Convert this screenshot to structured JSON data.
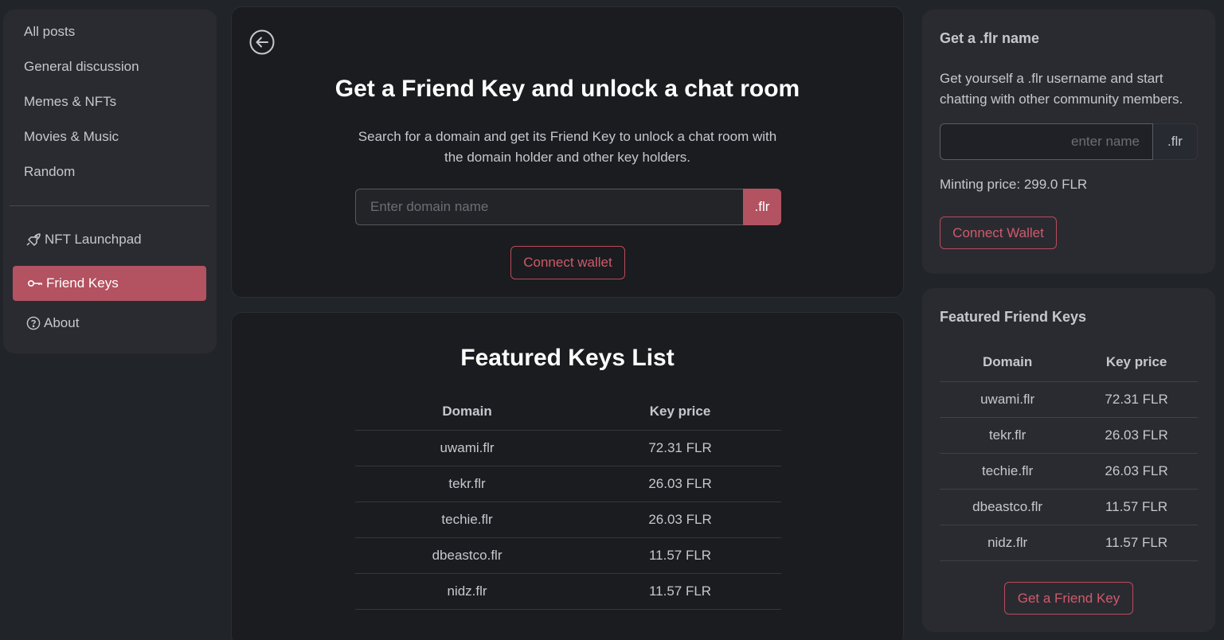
{
  "sidebar": {
    "items": [
      {
        "label": "All posts"
      },
      {
        "label": "General discussion"
      },
      {
        "label": "Memes & NFTs"
      },
      {
        "label": "Movies & Music"
      },
      {
        "label": "Random"
      }
    ],
    "special_items": [
      {
        "label": "NFT Launchpad",
        "icon": "rocket-icon"
      },
      {
        "label": "Friend Keys",
        "icon": "key-icon",
        "active": true
      },
      {
        "label": "About",
        "icon": "help-circle-icon"
      }
    ]
  },
  "hero": {
    "back_icon": "arrow-left-circle-icon",
    "title": "Get a Friend Key and unlock a chat room",
    "description": "Search for a domain and get its Friend Key to unlock a chat room with the domain holder and other key holders.",
    "search_placeholder": "Enter domain name",
    "search_value": "",
    "suffix": ".flr",
    "connect_label": "Connect wallet"
  },
  "featured_list": {
    "title": "Featured Keys List",
    "columns": [
      "Domain",
      "Key price"
    ],
    "rows": [
      {
        "domain": "uwami.flr",
        "price": "72.31 FLR"
      },
      {
        "domain": "tekr.flr",
        "price": "26.03 FLR"
      },
      {
        "domain": "techie.flr",
        "price": "26.03 FLR"
      },
      {
        "domain": "dbeastco.flr",
        "price": "11.57 FLR"
      },
      {
        "domain": "nidz.flr",
        "price": "11.57 FLR"
      }
    ]
  },
  "flr_name": {
    "title": "Get a .flr name",
    "description": "Get yourself a .flr username and start chatting with other community members.",
    "input_placeholder": "enter name",
    "input_value": "",
    "suffix": ".flr",
    "minting_price": "Minting price: 299.0 FLR",
    "connect_label": "Connect Wallet"
  },
  "featured_friend_keys": {
    "title": "Featured Friend Keys",
    "columns": [
      "Domain",
      "Key price"
    ],
    "rows": [
      {
        "domain": "uwami.flr",
        "price": "72.31 FLR"
      },
      {
        "domain": "tekr.flr",
        "price": "26.03 FLR"
      },
      {
        "domain": "techie.flr",
        "price": "26.03 FLR"
      },
      {
        "domain": "dbeastco.flr",
        "price": "11.57 FLR"
      },
      {
        "domain": "nidz.flr",
        "price": "11.57 FLR"
      }
    ],
    "button_label": "Get a Friend Key"
  },
  "colors": {
    "accent": "#b35261",
    "accent_text": "#cf5a6b",
    "background": "#212429",
    "card": "#2a2b31",
    "main_card": "#1b1c1f"
  }
}
